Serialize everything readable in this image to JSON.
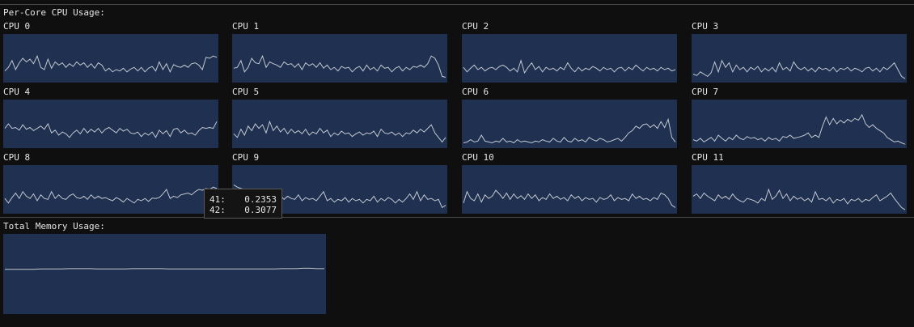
{
  "cpu_section": {
    "title": "Per-Core CPU Usage:",
    "cores": [
      {
        "label": "CPU 0",
        "samples": [
          0.22,
          0.3,
          0.45,
          0.25,
          0.4,
          0.5,
          0.42,
          0.48,
          0.38,
          0.55,
          0.3,
          0.25,
          0.48,
          0.28,
          0.42,
          0.35,
          0.4,
          0.3,
          0.38,
          0.32,
          0.42,
          0.35,
          0.4,
          0.3,
          0.38,
          0.28,
          0.4,
          0.35,
          0.22,
          0.28,
          0.2,
          0.25,
          0.22,
          0.28,
          0.2,
          0.26,
          0.3,
          0.22,
          0.3,
          0.2,
          0.28,
          0.32,
          0.22,
          0.42,
          0.25,
          0.38,
          0.2,
          0.36,
          0.32,
          0.3,
          0.35,
          0.3,
          0.38,
          0.4,
          0.35,
          0.25,
          0.52,
          0.5,
          0.55,
          0.52
        ]
      },
      {
        "label": "CPU 1",
        "samples": [
          0.28,
          0.3,
          0.45,
          0.2,
          0.3,
          0.5,
          0.4,
          0.38,
          0.55,
          0.3,
          0.42,
          0.38,
          0.35,
          0.3,
          0.42,
          0.36,
          0.38,
          0.3,
          0.38,
          0.25,
          0.4,
          0.34,
          0.38,
          0.3,
          0.4,
          0.28,
          0.35,
          0.25,
          0.3,
          0.22,
          0.32,
          0.28,
          0.3,
          0.2,
          0.28,
          0.32,
          0.22,
          0.35,
          0.25,
          0.3,
          0.22,
          0.35,
          0.28,
          0.3,
          0.2,
          0.28,
          0.32,
          0.22,
          0.3,
          0.25,
          0.32,
          0.3,
          0.35,
          0.3,
          0.38,
          0.55,
          0.5,
          0.35,
          0.1,
          0.08
        ]
      },
      {
        "label": "CPU 2",
        "samples": [
          0.3,
          0.2,
          0.28,
          0.35,
          0.25,
          0.3,
          0.22,
          0.28,
          0.3,
          0.25,
          0.32,
          0.35,
          0.3,
          0.22,
          0.28,
          0.2,
          0.45,
          0.18,
          0.3,
          0.4,
          0.25,
          0.32,
          0.2,
          0.3,
          0.25,
          0.28,
          0.22,
          0.3,
          0.25,
          0.4,
          0.28,
          0.2,
          0.3,
          0.22,
          0.28,
          0.25,
          0.32,
          0.28,
          0.22,
          0.3,
          0.25,
          0.28,
          0.2,
          0.28,
          0.3,
          0.22,
          0.3,
          0.25,
          0.35,
          0.28,
          0.22,
          0.3,
          0.25,
          0.28,
          0.22,
          0.3,
          0.25,
          0.28,
          0.22,
          0.25
        ]
      },
      {
        "label": "CPU 3",
        "samples": [
          0.15,
          0.12,
          0.2,
          0.15,
          0.1,
          0.18,
          0.42,
          0.2,
          0.45,
          0.3,
          0.4,
          0.2,
          0.35,
          0.25,
          0.3,
          0.2,
          0.3,
          0.25,
          0.32,
          0.2,
          0.28,
          0.22,
          0.3,
          0.2,
          0.4,
          0.25,
          0.3,
          0.22,
          0.42,
          0.3,
          0.25,
          0.3,
          0.22,
          0.28,
          0.2,
          0.3,
          0.25,
          0.28,
          0.22,
          0.3,
          0.2,
          0.28,
          0.25,
          0.3,
          0.22,
          0.28,
          0.25,
          0.2,
          0.28,
          0.3,
          0.22,
          0.28,
          0.2,
          0.3,
          0.25,
          0.32,
          0.4,
          0.25,
          0.1,
          0.05
        ]
      },
      {
        "label": "CPU 4",
        "samples": [
          0.4,
          0.5,
          0.4,
          0.42,
          0.36,
          0.48,
          0.38,
          0.42,
          0.35,
          0.4,
          0.45,
          0.38,
          0.5,
          0.3,
          0.36,
          0.25,
          0.32,
          0.28,
          0.2,
          0.3,
          0.36,
          0.28,
          0.4,
          0.3,
          0.38,
          0.32,
          0.4,
          0.3,
          0.38,
          0.42,
          0.36,
          0.3,
          0.4,
          0.34,
          0.38,
          0.3,
          0.28,
          0.32,
          0.22,
          0.3,
          0.25,
          0.32,
          0.2,
          0.36,
          0.28,
          0.35,
          0.22,
          0.38,
          0.4,
          0.3,
          0.36,
          0.28,
          0.3,
          0.25,
          0.35,
          0.42,
          0.4,
          0.42,
          0.4,
          0.55
        ]
      },
      {
        "label": "CPU 5",
        "samples": [
          0.28,
          0.2,
          0.38,
          0.25,
          0.45,
          0.35,
          0.5,
          0.4,
          0.48,
          0.3,
          0.55,
          0.35,
          0.45,
          0.32,
          0.4,
          0.28,
          0.38,
          0.3,
          0.35,
          0.28,
          0.38,
          0.25,
          0.32,
          0.28,
          0.4,
          0.3,
          0.36,
          0.22,
          0.3,
          0.25,
          0.34,
          0.28,
          0.3,
          0.22,
          0.28,
          0.32,
          0.25,
          0.3,
          0.28,
          0.34,
          0.22,
          0.38,
          0.3,
          0.28,
          0.32,
          0.25,
          0.3,
          0.22,
          0.3,
          0.28,
          0.36,
          0.3,
          0.38,
          0.32,
          0.4,
          0.48,
          0.3,
          0.2,
          0.1,
          0.2
        ]
      },
      {
        "label": "CPU 6",
        "samples": [
          0.08,
          0.1,
          0.15,
          0.1,
          0.12,
          0.25,
          0.12,
          0.1,
          0.08,
          0.12,
          0.1,
          0.18,
          0.1,
          0.12,
          0.08,
          0.15,
          0.1,
          0.12,
          0.1,
          0.08,
          0.12,
          0.1,
          0.15,
          0.12,
          0.1,
          0.18,
          0.12,
          0.1,
          0.2,
          0.12,
          0.1,
          0.18,
          0.12,
          0.15,
          0.1,
          0.2,
          0.15,
          0.12,
          0.18,
          0.15,
          0.1,
          0.12,
          0.15,
          0.18,
          0.12,
          0.2,
          0.3,
          0.35,
          0.45,
          0.4,
          0.48,
          0.5,
          0.42,
          0.48,
          0.4,
          0.55,
          0.42,
          0.6,
          0.2,
          0.1
        ]
      },
      {
        "label": "CPU 7",
        "samples": [
          0.15,
          0.12,
          0.18,
          0.1,
          0.15,
          0.2,
          0.12,
          0.25,
          0.18,
          0.12,
          0.2,
          0.15,
          0.25,
          0.18,
          0.15,
          0.22,
          0.18,
          0.2,
          0.15,
          0.18,
          0.12,
          0.2,
          0.15,
          0.18,
          0.12,
          0.22,
          0.2,
          0.25,
          0.18,
          0.2,
          0.22,
          0.25,
          0.3,
          0.2,
          0.25,
          0.2,
          0.45,
          0.65,
          0.48,
          0.62,
          0.5,
          0.58,
          0.52,
          0.6,
          0.55,
          0.62,
          0.58,
          0.7,
          0.5,
          0.42,
          0.48,
          0.4,
          0.35,
          0.3,
          0.2,
          0.15,
          0.1,
          0.12,
          0.08,
          0.05
        ]
      },
      {
        "label": "CPU 8",
        "samples": [
          0.3,
          0.2,
          0.32,
          0.42,
          0.3,
          0.45,
          0.35,
          0.3,
          0.4,
          0.25,
          0.38,
          0.3,
          0.28,
          0.45,
          0.3,
          0.38,
          0.3,
          0.28,
          0.36,
          0.4,
          0.32,
          0.3,
          0.35,
          0.28,
          0.38,
          0.3,
          0.35,
          0.3,
          0.32,
          0.28,
          0.25,
          0.32,
          0.28,
          0.22,
          0.3,
          0.25,
          0.2,
          0.28,
          0.25,
          0.3,
          0.2353,
          0.3077,
          0.3,
          0.32,
          0.4,
          0.5,
          0.3,
          0.35,
          0.32,
          0.38,
          0.4,
          0.42,
          0.38,
          0.45,
          0.5,
          0.48,
          0.52,
          0.5,
          0.55,
          0.52
        ]
      },
      {
        "label": "CPU 9",
        "samples": [
          0.6,
          0.55,
          0.52,
          0.5,
          0.48,
          0.45,
          0.42,
          0.4,
          0.38,
          0.35,
          0.3,
          0.38,
          0.3,
          0.36,
          0.28,
          0.35,
          0.3,
          0.28,
          0.38,
          0.25,
          0.32,
          0.28,
          0.3,
          0.25,
          0.35,
          0.45,
          0.25,
          0.3,
          0.22,
          0.28,
          0.25,
          0.32,
          0.22,
          0.3,
          0.25,
          0.28,
          0.2,
          0.28,
          0.25,
          0.35,
          0.22,
          0.3,
          0.25,
          0.32,
          0.28,
          0.2,
          0.28,
          0.22,
          0.3,
          0.4,
          0.28,
          0.45,
          0.25,
          0.38,
          0.28,
          0.3,
          0.25,
          0.28,
          0.1,
          0.15
        ]
      },
      {
        "label": "CPU 10",
        "samples": [
          0.2,
          0.45,
          0.3,
          0.25,
          0.4,
          0.22,
          0.38,
          0.3,
          0.35,
          0.48,
          0.4,
          0.3,
          0.42,
          0.28,
          0.4,
          0.3,
          0.36,
          0.28,
          0.4,
          0.3,
          0.38,
          0.25,
          0.32,
          0.28,
          0.4,
          0.3,
          0.35,
          0.28,
          0.32,
          0.25,
          0.38,
          0.3,
          0.35,
          0.25,
          0.32,
          0.28,
          0.3,
          0.22,
          0.32,
          0.28,
          0.3,
          0.38,
          0.25,
          0.32,
          0.28,
          0.3,
          0.25,
          0.4,
          0.3,
          0.35,
          0.28,
          0.3,
          0.25,
          0.32,
          0.28,
          0.42,
          0.38,
          0.3,
          0.15,
          0.1
        ]
      },
      {
        "label": "CPU 11",
        "samples": [
          0.35,
          0.4,
          0.3,
          0.42,
          0.35,
          0.3,
          0.25,
          0.38,
          0.3,
          0.35,
          0.28,
          0.4,
          0.3,
          0.25,
          0.22,
          0.3,
          0.28,
          0.25,
          0.2,
          0.3,
          0.25,
          0.5,
          0.28,
          0.35,
          0.48,
          0.3,
          0.4,
          0.25,
          0.35,
          0.28,
          0.32,
          0.25,
          0.3,
          0.22,
          0.45,
          0.28,
          0.3,
          0.25,
          0.32,
          0.2,
          0.28,
          0.25,
          0.3,
          0.18,
          0.28,
          0.25,
          0.3,
          0.22,
          0.28,
          0.25,
          0.32,
          0.38,
          0.25,
          0.3,
          0.35,
          0.42,
          0.3,
          0.2,
          0.1,
          0.05
        ]
      }
    ]
  },
  "tooltip": {
    "rows": [
      {
        "index": "41:",
        "value": "0.2353"
      },
      {
        "index": "42:",
        "value": "0.3077"
      }
    ]
  },
  "memory_section": {
    "title": "Total Memory Usage:",
    "samples": [
      0.56,
      0.56,
      0.56,
      0.56,
      0.56,
      0.565,
      0.565,
      0.565,
      0.565,
      0.57,
      0.57,
      0.57,
      0.57,
      0.565,
      0.565,
      0.565,
      0.565,
      0.565,
      0.57,
      0.57,
      0.57,
      0.57,
      0.57,
      0.565,
      0.565,
      0.565,
      0.565,
      0.565,
      0.565,
      0.565,
      0.565,
      0.565,
      0.565,
      0.565,
      0.565,
      0.565,
      0.565,
      0.565,
      0.565,
      0.57,
      0.57,
      0.57,
      0.575,
      0.575,
      0.57,
      0.57
    ]
  },
  "colors": {
    "background": "#0f0f0f",
    "plot_background": "#1f3050",
    "line": "#c4c8d0",
    "separator": "#4a4a4a",
    "text": "#e6e6e6"
  }
}
